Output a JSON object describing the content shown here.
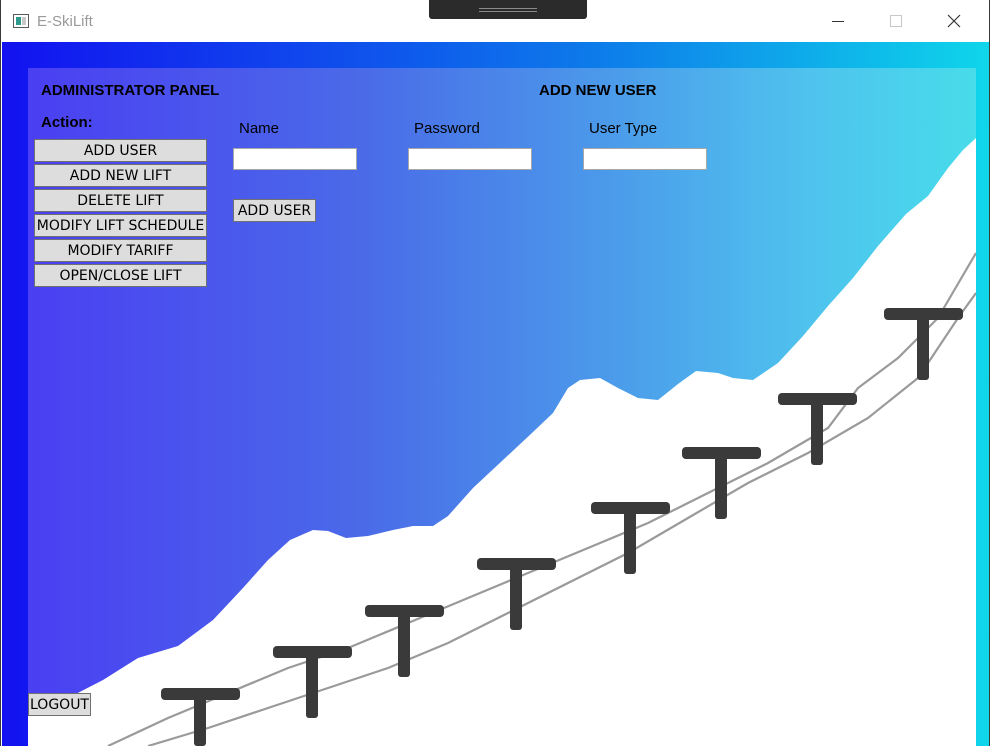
{
  "window": {
    "title": "E-SkiLift",
    "controls": {
      "minimize": "minimize",
      "maximize": "maximize",
      "close": "close"
    }
  },
  "panel": {
    "heading": "ADMINISTRATOR PANEL",
    "action_label": "Action:",
    "actions": [
      "ADD USER",
      "ADD NEW LIFT",
      "DELETE LIFT",
      "MODIFY LIFT SCHEDULE",
      "MODIFY TARIFF",
      "OPEN/CLOSE LIFT"
    ],
    "logout_label": "LOGOUT"
  },
  "form": {
    "title": "ADD NEW USER",
    "fields": [
      {
        "label": "Name",
        "value": ""
      },
      {
        "label": "Password",
        "value": ""
      },
      {
        "label": "User Type",
        "value": ""
      }
    ],
    "submit_label": "ADD USER"
  },
  "colors": {
    "gradient_left": "#1212f0",
    "gradient_right": "#0fd6ea",
    "button_bg": "#dddddd",
    "pylon": "#3a3a3a",
    "snow": "#ffffff"
  }
}
